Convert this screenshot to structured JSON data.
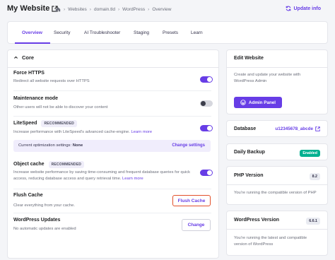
{
  "header": {
    "site_title": "My Website",
    "breadcrumbs": [
      "Websites",
      "domain.tld",
      "WordPress",
      "Overview"
    ],
    "update_info": "Update info"
  },
  "tabs": [
    {
      "label": "Overview",
      "active": true
    },
    {
      "label": "Security",
      "active": false
    },
    {
      "label": "AI Troubleshooter",
      "active": false
    },
    {
      "label": "Staging",
      "active": false
    },
    {
      "label": "Presets",
      "active": false
    },
    {
      "label": "Learn",
      "active": false
    }
  ],
  "core": {
    "heading": "Core",
    "force_https": {
      "title": "Force HTTPS",
      "desc": "Redirect all website requests over HTTPS",
      "enabled": true
    },
    "maintenance": {
      "title": "Maintenance mode",
      "desc": "Other users will not be able to discover your content",
      "enabled": false
    },
    "litespeed": {
      "title": "LiteSpeed",
      "badge": "RECOMMENDED",
      "desc": "Increase performance with LiteSpeed's advanced cache-engine.",
      "learn_more": "Learn more",
      "enabled": true,
      "opt_label": "Current optimization settings:",
      "opt_value": "None",
      "opt_link": "Change settings"
    },
    "object_cache": {
      "title": "Object cache",
      "badge": "RECOMMENDED",
      "desc": "Increase website performance by saving time-consuming and frequent database queries for quick access, reducing database access and query retrieval time.",
      "learn_more": "Learn more",
      "enabled": true
    },
    "flush_cache": {
      "title": "Flush Cache",
      "desc": "Clear everything from your cache.",
      "button": "Flush Cache"
    },
    "wp_updates": {
      "title": "WordPress Updates",
      "desc": "No automatic updates are enabled",
      "button": "Change"
    }
  },
  "sidebar": {
    "edit_website": {
      "title": "Edit Website",
      "desc": "Create and update your website with WordPress Admin",
      "button": "Admin Panel"
    },
    "database": {
      "title": "Database",
      "value": "u12345678_abcde"
    },
    "backup": {
      "title": "Daily Backup",
      "status": "Enabled"
    },
    "php": {
      "title": "PHP Version",
      "version": "8.2",
      "desc": "You're running the compatible version of PHP"
    },
    "wordpress": {
      "title": "WordPress Version",
      "version": "6.6.1",
      "desc": "You're running the latest and compatible version of WordPress"
    }
  },
  "colors": {
    "accent": "#673de6",
    "enabled_badge": "#00b090",
    "highlight_border": "#e2502a"
  }
}
